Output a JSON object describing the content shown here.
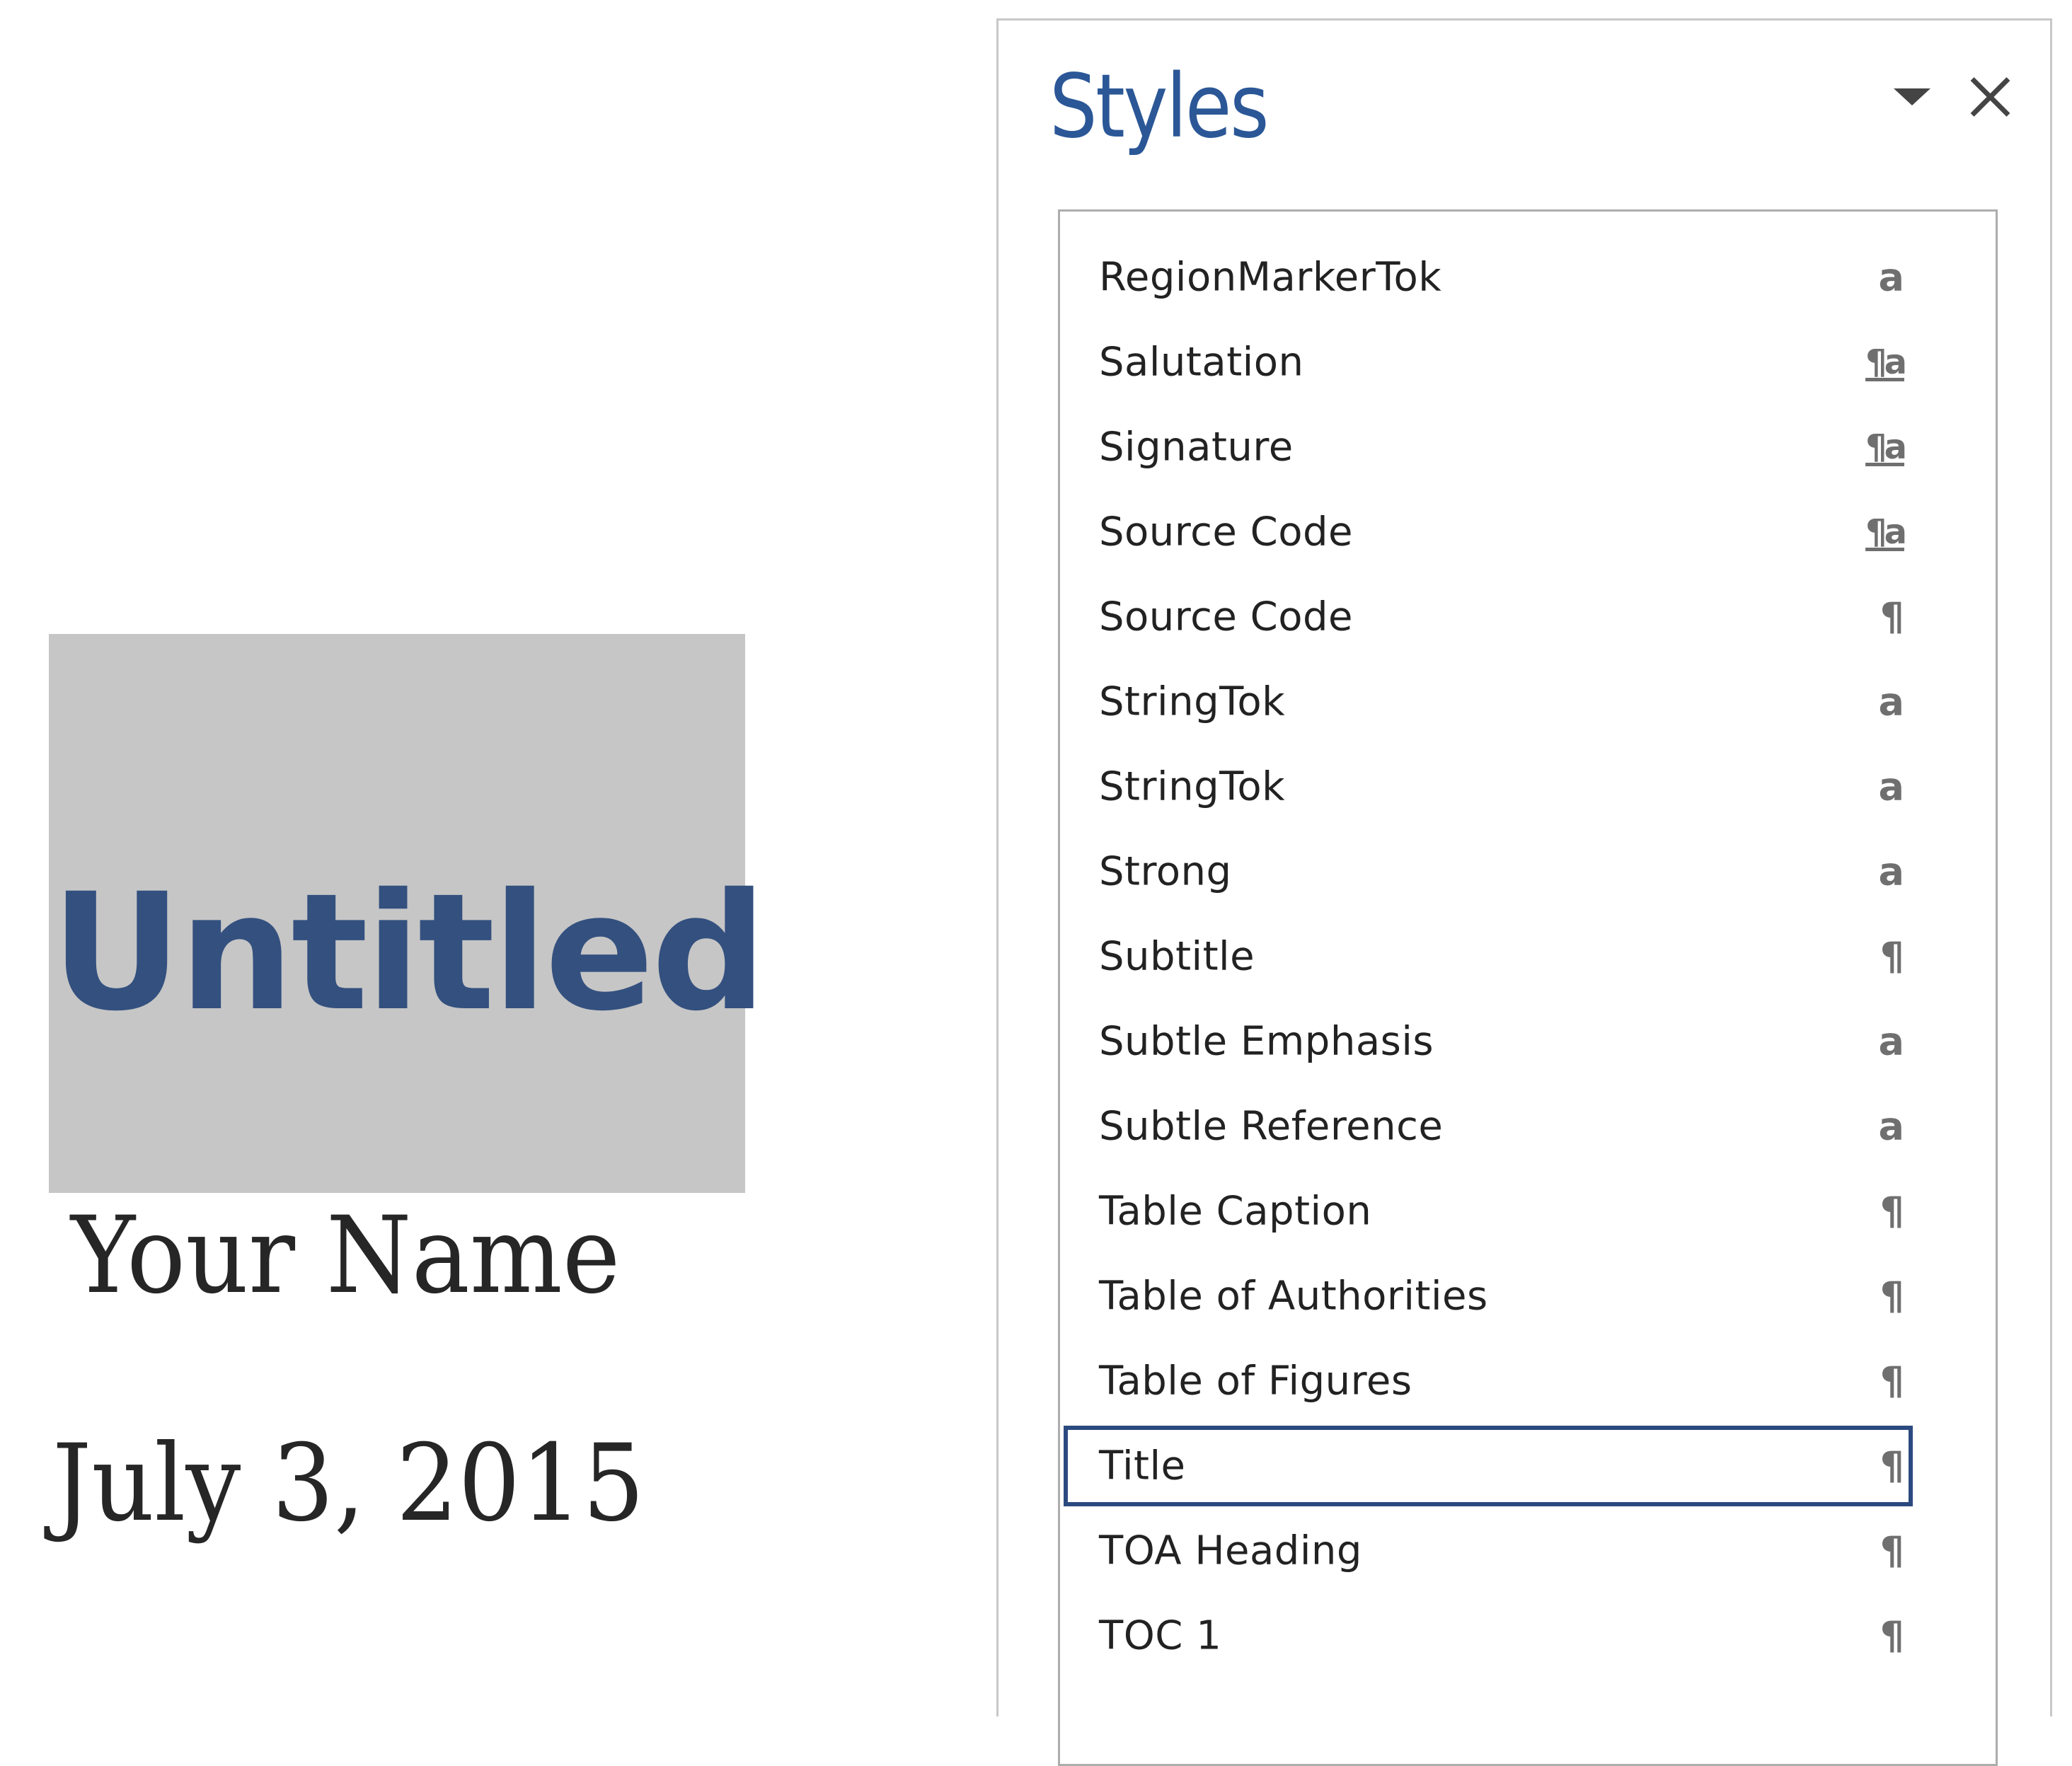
{
  "document": {
    "title": "Untitled",
    "author": "Your Name",
    "date": "July 3, 2015",
    "title_block_color": "#c6c6c6",
    "title_color": "#33507f"
  },
  "styles_pane": {
    "title": "Styles",
    "menu_icon": "dropdown-triangle-icon",
    "close_icon": "close-icon",
    "accent_color": "#2b5797",
    "selected_style": "Title",
    "items": [
      {
        "label": "RegionMarkerTok",
        "type": "character",
        "icon": "a"
      },
      {
        "label": "Salutation",
        "type": "linked",
        "icon": "¶a"
      },
      {
        "label": "Signature",
        "type": "linked",
        "icon": "¶a"
      },
      {
        "label": "Source Code",
        "type": "linked",
        "icon": "¶a"
      },
      {
        "label": "Source Code",
        "type": "paragraph",
        "icon": "¶"
      },
      {
        "label": "StringTok",
        "type": "character",
        "icon": "a"
      },
      {
        "label": "StringTok",
        "type": "character",
        "icon": "a"
      },
      {
        "label": "Strong",
        "type": "character",
        "icon": "a"
      },
      {
        "label": "Subtitle",
        "type": "paragraph",
        "icon": "¶"
      },
      {
        "label": "Subtle Emphasis",
        "type": "character",
        "icon": "a"
      },
      {
        "label": "Subtle Reference",
        "type": "character",
        "icon": "a"
      },
      {
        "label": "Table Caption",
        "type": "paragraph",
        "icon": "¶"
      },
      {
        "label": "Table of Authorities",
        "type": "paragraph",
        "icon": "¶"
      },
      {
        "label": "Table of Figures",
        "type": "paragraph",
        "icon": "¶"
      },
      {
        "label": "Title",
        "type": "paragraph",
        "icon": "¶",
        "selected": true
      },
      {
        "label": "TOA Heading",
        "type": "paragraph",
        "icon": "¶"
      },
      {
        "label": "TOC 1",
        "type": "paragraph",
        "icon": "¶"
      }
    ]
  }
}
